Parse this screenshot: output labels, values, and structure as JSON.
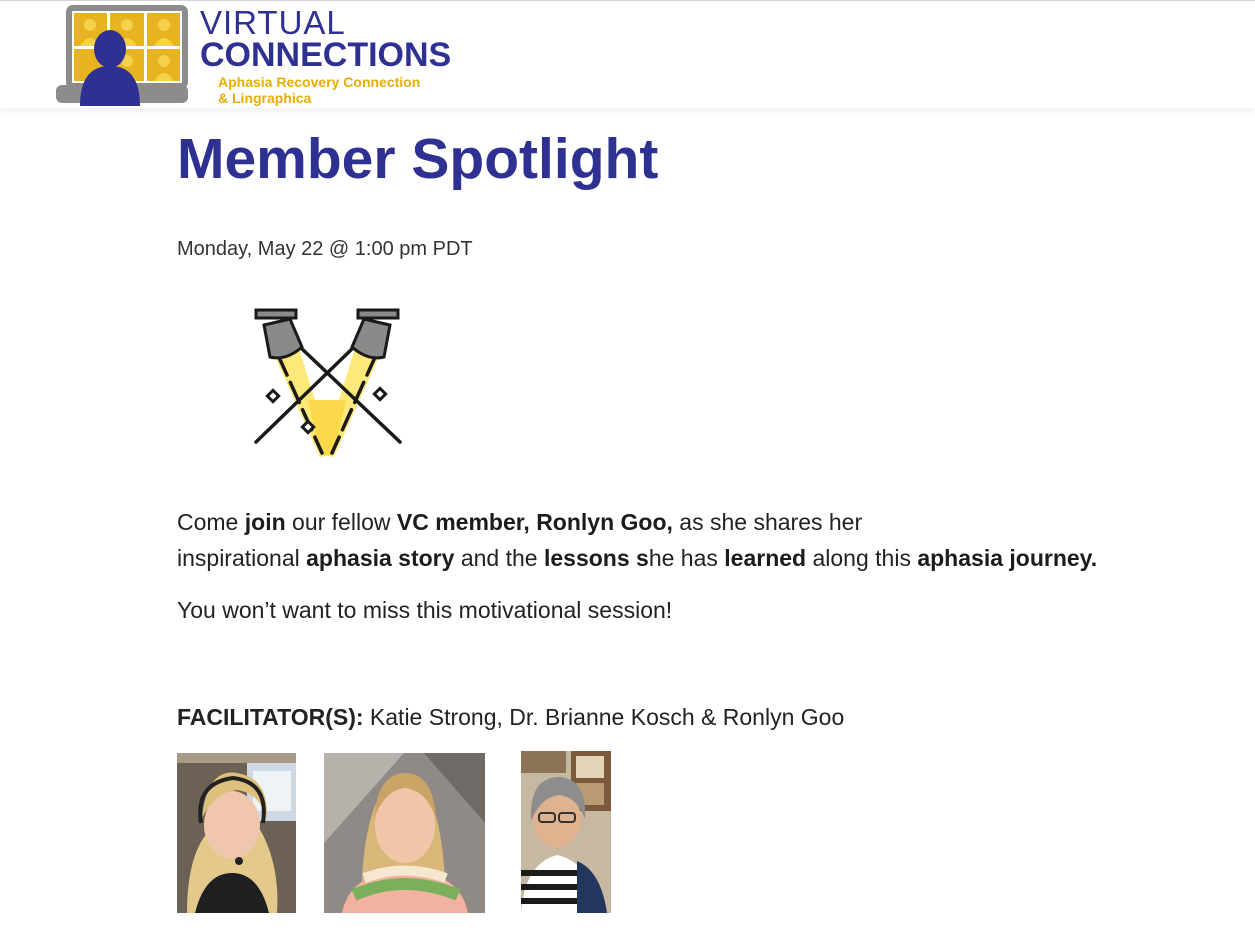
{
  "header": {
    "logo": {
      "line1": "VIRTUAL",
      "line2": "CONNECTIONS",
      "subtitle_line1": "Aphasia Recovery Connection",
      "subtitle_line2": "& Lingraphica"
    }
  },
  "event": {
    "title": "Member Spotlight",
    "datetime": "Monday, May 22 @ 1:00 pm PDT",
    "description": {
      "parts": [
        {
          "text": "Come ",
          "bold": false
        },
        {
          "text": "join",
          "bold": true
        },
        {
          "text": " our fellow ",
          "bold": false
        },
        {
          "text": "VC member, Ronlyn Goo,",
          "bold": true
        },
        {
          "text": " as she shares her",
          "bold": false
        },
        {
          "text": "inspirational ",
          "bold": false
        },
        {
          "text": "aphasia story",
          "bold": true
        },
        {
          "text": " and the ",
          "bold": false
        },
        {
          "text": "lessons s",
          "bold": true
        },
        {
          "text": "he has ",
          "bold": false
        },
        {
          "text": "learned",
          "bold": true
        },
        {
          "text": " along this ",
          "bold": false
        },
        {
          "text": "aphasia journey.",
          "bold": true
        }
      ]
    },
    "motivation": "You won’t want to miss this motivational session!",
    "facilitators_label": "FACILITATOR(S):",
    "facilitators_names": " Katie Strong, Dr. Brianne Kosch & Ronlyn Goo"
  },
  "colors": {
    "brand_blue": "#2e3192",
    "brand_gold": "#e6ad08",
    "spotlight_yellow": "#fde872",
    "lamp_gray": "#8a8a8a"
  },
  "icons": {
    "illustration": "spotlight-illustration-icon",
    "logo_mark": "video-grid-laptop-logo-icon"
  }
}
